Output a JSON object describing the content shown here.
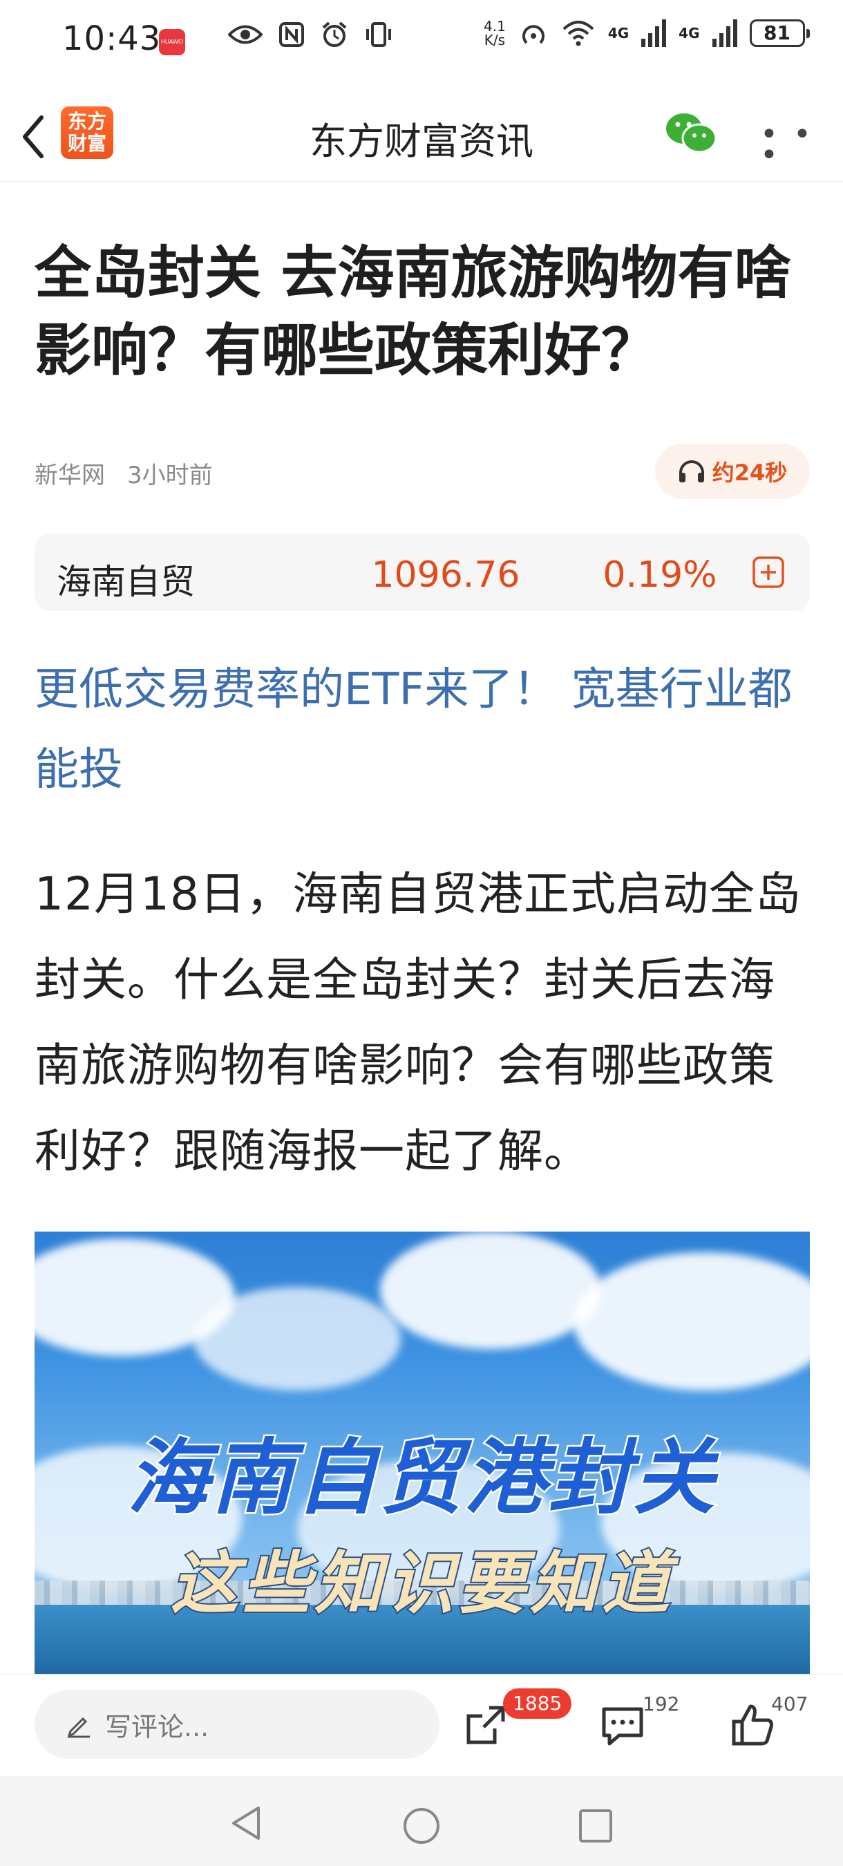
{
  "status_bar": {
    "time": "10:43",
    "network_speed_value": "4.1",
    "network_speed_unit": "K/s",
    "signal_1": "4G",
    "signal_2": "4G",
    "battery": "81",
    "app_notification_text": "HUAWEI"
  },
  "nav": {
    "title": "东方财富资讯",
    "logo_line1": "东方",
    "logo_line2": "财富",
    "icons": [
      "back-chevron-icon",
      "wechat-icon",
      "more-icon"
    ]
  },
  "article": {
    "headline": "全岛封关 去海南旅游购物有啥影响？有哪些政策利好？",
    "source": "新华网",
    "time_ago": "3小时前",
    "listen_label": "约24秒",
    "promo_link": "更低交易费率的ETF来了！ 宽基行业都能投",
    "body": "12月18日，海南自贸港正式启动全岛封关。什么是全岛封关？封关后去海南旅游购物有啥影响？会有哪些政策利好？跟随海报一起了解。"
  },
  "stock": {
    "name": "海南自贸",
    "price": "1096.76",
    "change": "0.19%",
    "color": "#e24a1a"
  },
  "poster": {
    "line1": "海南自贸港封关",
    "line2": "这些知识要知道"
  },
  "bottom_bar": {
    "comment_placeholder": "写评论...",
    "share_count": "1885",
    "comment_count": "192",
    "like_count": "407"
  },
  "colors": {
    "accent": "#e4521c",
    "link": "#3d6fb0",
    "badge": "#ee3b2f"
  }
}
